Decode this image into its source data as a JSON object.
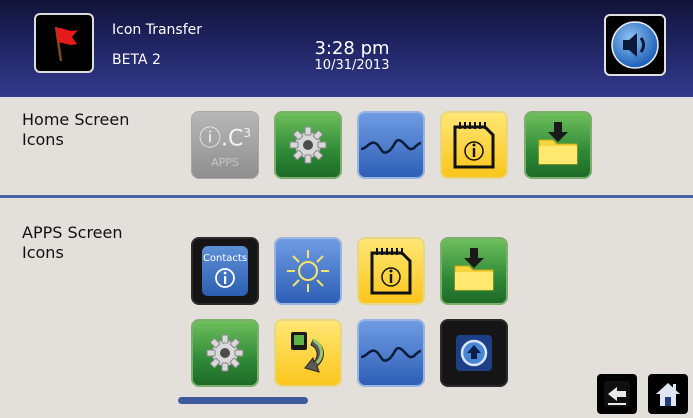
{
  "header": {
    "app_title": "Icon Transfer",
    "app_subtitle": "BETA 2",
    "time": "3:28 pm",
    "date": "10/31/2013"
  },
  "sections": {
    "home": {
      "label_line1": "Home Screen",
      "label_line2": "Icons"
    },
    "apps": {
      "label_line1": "APPS Screen",
      "label_line2": "Icons"
    }
  },
  "icons": {
    "ic3": {
      "main": "ⓘ.C",
      "sup": "3",
      "sub": "APPS"
    },
    "contacts": {
      "label": "Contacts"
    }
  },
  "colors": {
    "header_top": "#111338",
    "header_bottom": "#333a8c",
    "divider": "#4a61a8",
    "background": "#e3e0db"
  }
}
